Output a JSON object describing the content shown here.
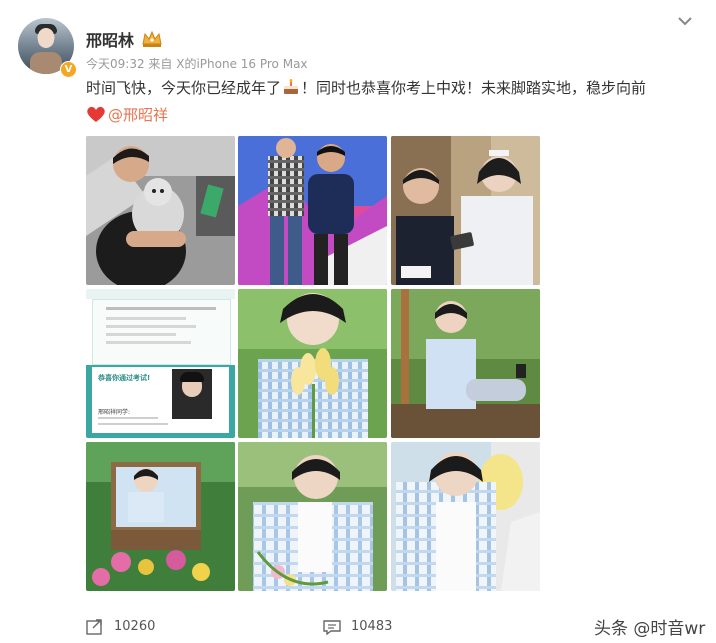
{
  "user": {
    "name": "邢昭林",
    "verified_badge": "V",
    "time": "今天09:32",
    "source": "来自 X的iPhone 16 Pro Max"
  },
  "post": {
    "text_part1": "时间飞快，今天你已经成年了",
    "text_part2": "！同时也恭喜你考上中戏！未来脚踏实地，稳步向前",
    "mention": "@邢昭祥"
  },
  "photos": {
    "certificate_heading": "恭喜你通过考试!",
    "certificate_name_line": "邢昭祥同学:"
  },
  "footer": {
    "reposts": "10260",
    "comments": "10483",
    "watermark": "头条 @时音wr"
  },
  "colors": {
    "mention": "#eb7350",
    "meta_gray": "#999999",
    "verified": "#f5a623"
  },
  "icons": [
    "crown-icon",
    "cake-emoji-icon",
    "heart-emoji-icon",
    "repost-icon",
    "comment-icon",
    "chevron-down-icon"
  ]
}
